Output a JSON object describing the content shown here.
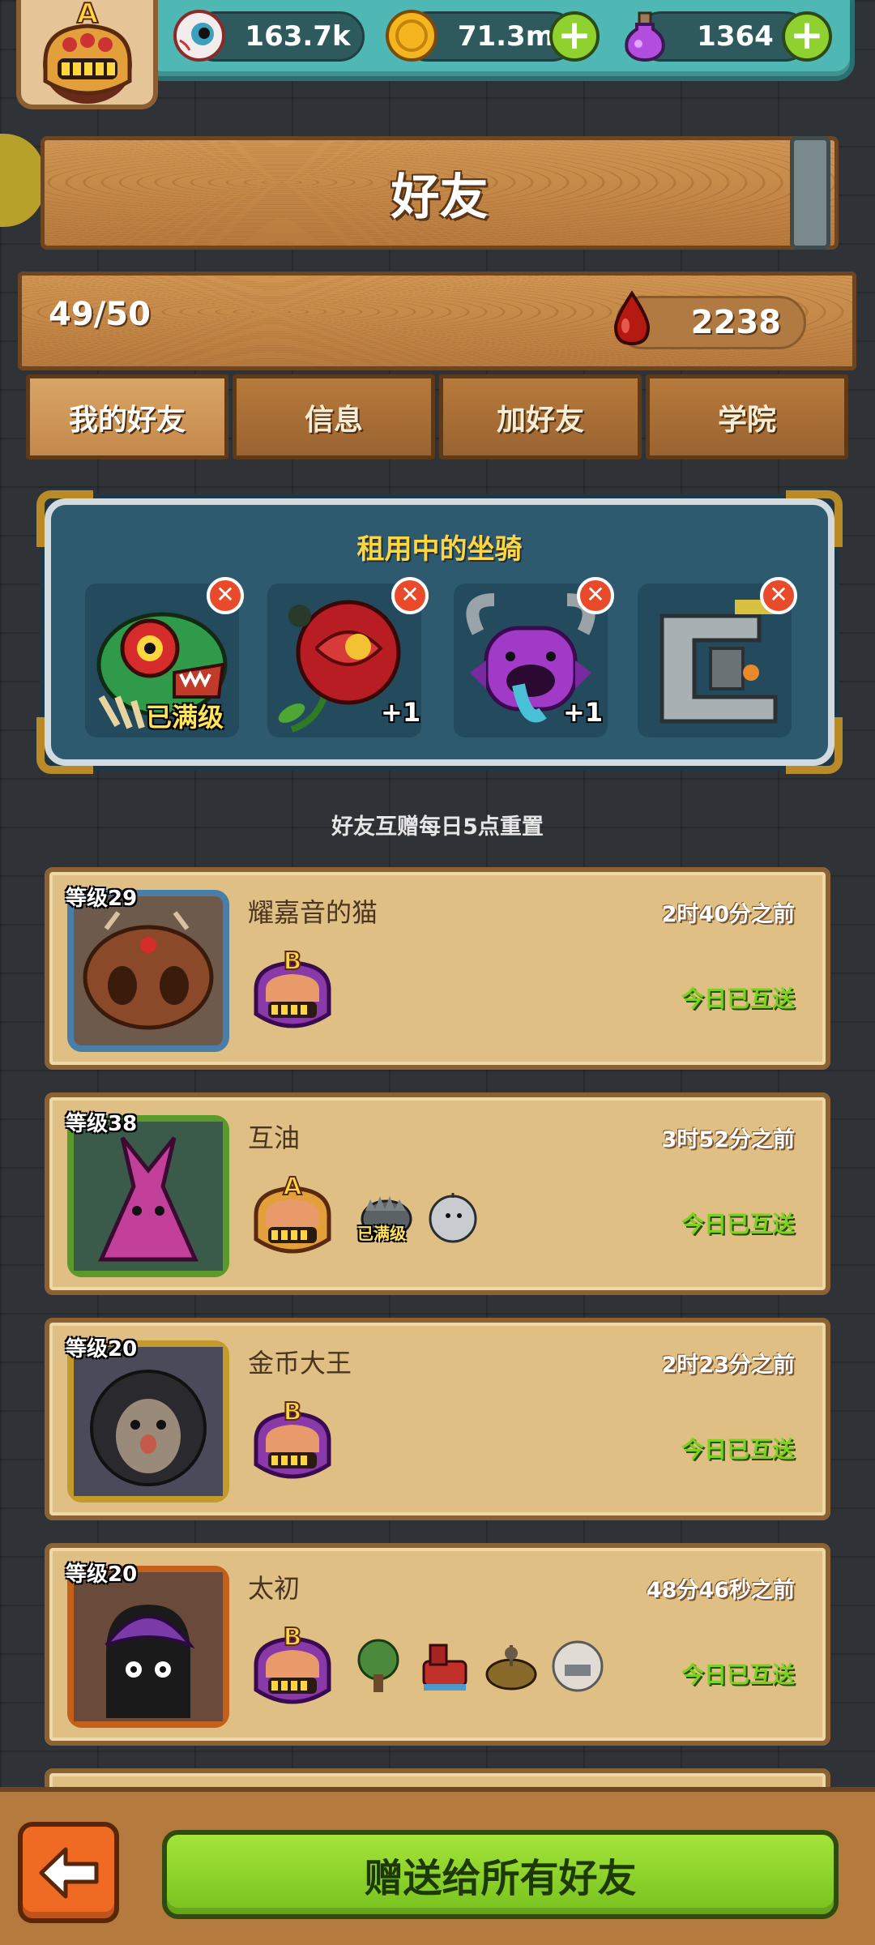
{
  "header": {
    "player_rank": "A",
    "resources": [
      {
        "name": "eyeball",
        "value": "163.7k",
        "icon": "eyeball-icon"
      },
      {
        "name": "coins",
        "value": "71.3m",
        "icon": "coin-icon"
      },
      {
        "name": "potion",
        "value": "1364",
        "icon": "potion-icon"
      }
    ]
  },
  "title": "好友",
  "stats": {
    "friend_count": "49/50",
    "blood": "2238"
  },
  "tabs": [
    {
      "label": "我的好友",
      "active": true
    },
    {
      "label": "信息"
    },
    {
      "label": "加好友"
    },
    {
      "label": "学院"
    }
  ],
  "mounts": {
    "title": "租用中的坐骑",
    "slots": [
      {
        "tag": "已满级",
        "icon": "red-dragon-mount-icon"
      },
      {
        "tag": "+1",
        "icon": "rose-mount-icon"
      },
      {
        "tag": "+1",
        "icon": "purple-monster-mount-icon"
      },
      {
        "tag": "",
        "icon": "mech-mount-icon"
      }
    ]
  },
  "reset_note": "好友互赠每日5点重置",
  "friends": [
    {
      "level": "等级29",
      "name": "耀嘉音的猫",
      "time": "2时40分之前",
      "status": "今日已互送",
      "rank": "B",
      "mounts": []
    },
    {
      "level": "等级38",
      "name": "互油",
      "time": "3时52分之前",
      "status": "今日已互送",
      "rank": "A",
      "mounts": [
        {
          "tag": "已满级"
        },
        {
          "tag": ""
        }
      ]
    },
    {
      "level": "等级20",
      "name": "金币大王",
      "time": "2时23分之前",
      "status": "今日已互送",
      "rank": "B",
      "mounts": []
    },
    {
      "level": "等级20",
      "name": "太初",
      "time": "48分46秒之前",
      "status": "今日已互送",
      "rank": "B",
      "mounts": [
        {
          "tag": ""
        },
        {
          "tag": ""
        },
        {
          "tag": ""
        },
        {
          "tag": ""
        }
      ]
    }
  ],
  "footer": {
    "gift_all_label": "赠送给所有好友"
  }
}
